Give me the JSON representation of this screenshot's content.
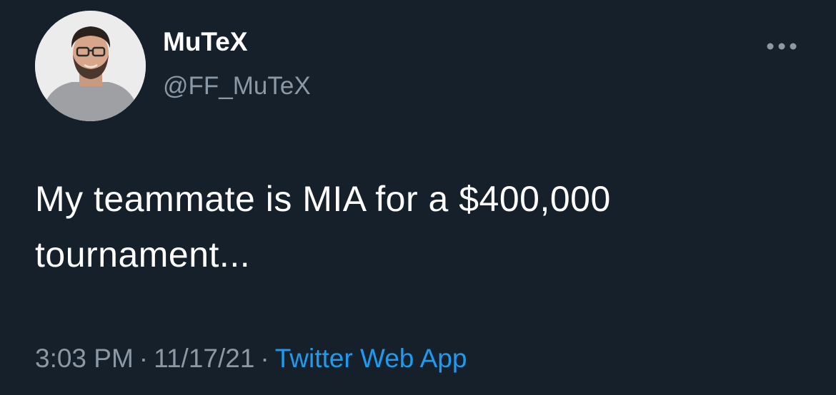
{
  "tweet": {
    "author": {
      "display_name": "MuTeX",
      "handle": "@FF_MuTeX"
    },
    "more_icon": "ellipsis-icon",
    "text": "My teammate is MIA for a $400,000 tournament...",
    "time": "3:03 PM",
    "date": "11/17/21",
    "separator": "·",
    "source": "Twitter Web App"
  },
  "colors": {
    "background": "#15202b",
    "primary_text": "#ffffff",
    "secondary_text": "#8b98a5",
    "accent": "#1d9bf0"
  }
}
